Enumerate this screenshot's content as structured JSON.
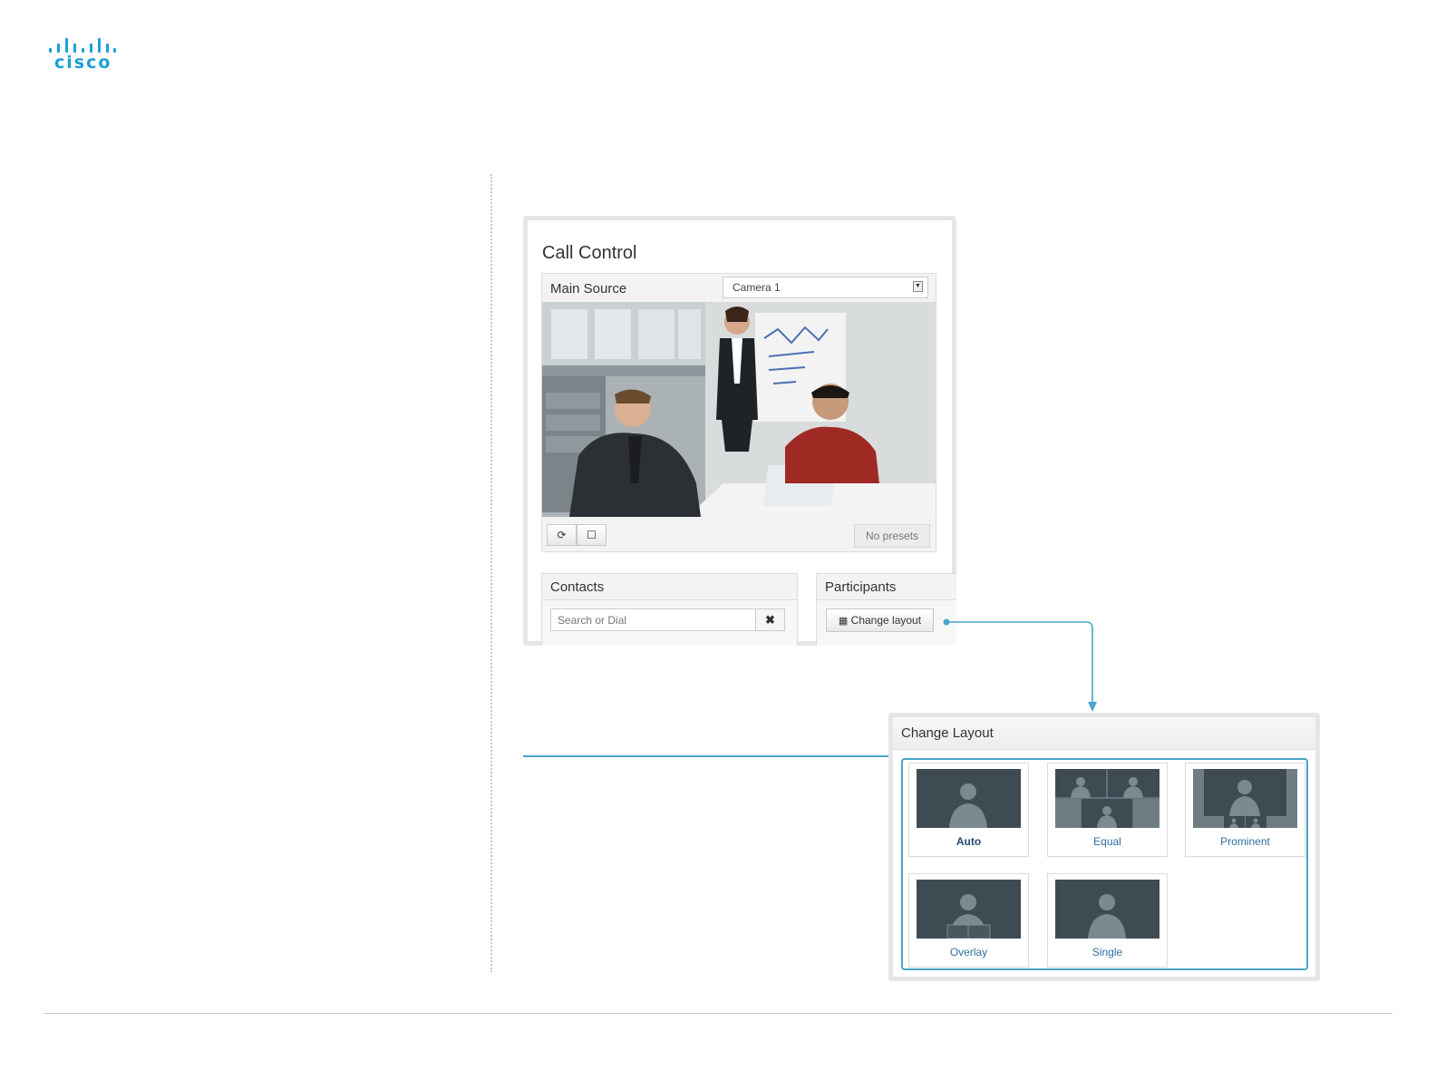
{
  "logo": {
    "text": "cisco"
  },
  "call_control": {
    "title": "Call Control",
    "main_source": {
      "label": "Main Source",
      "selected": "Camera 1"
    },
    "camera_controls": {
      "refresh_icon": "refresh-icon",
      "square_icon": "square-icon",
      "presets_label": "No presets"
    },
    "contacts": {
      "title": "Contacts",
      "search_placeholder": "Search or Dial",
      "clear_icon": "close-icon"
    },
    "participants": {
      "title": "Participants",
      "change_layout_label": "Change layout",
      "grid_icon": "grid-icon"
    }
  },
  "change_layout": {
    "title": "Change Layout",
    "options": [
      {
        "label": "Auto"
      },
      {
        "label": "Equal"
      },
      {
        "label": "Prominent"
      },
      {
        "label": "Overlay"
      },
      {
        "label": "Single"
      }
    ]
  },
  "colors": {
    "brand": "#1ba0d7",
    "highlight": "#4aa3c8",
    "thumb_bg": "#3f4b53",
    "label_blue": "#2f6f9f"
  }
}
